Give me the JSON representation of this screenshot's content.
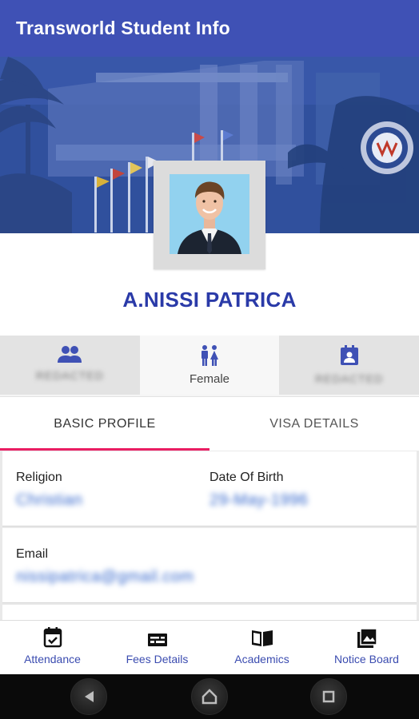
{
  "app": {
    "title": "Transworld Student Info"
  },
  "student": {
    "name": "A.NISSI PATRICA"
  },
  "info_tiles": [
    {
      "icon": "people-icon",
      "value": "REDACTED"
    },
    {
      "icon": "gender-icon",
      "value": "Female"
    },
    {
      "icon": "contact-card-icon",
      "value": "REDACTED"
    }
  ],
  "tabs": [
    {
      "label": "BASIC PROFILE",
      "selected": true
    },
    {
      "label": "VISA DETAILS",
      "selected": false
    }
  ],
  "profile": {
    "religion_label": "Religion",
    "religion_value": "Christian",
    "dob_label": "Date Of Birth",
    "dob_value": "29-May-1996",
    "email_label": "Email",
    "email_value": "nissipatrica@gmail.com"
  },
  "bottom_nav": [
    {
      "label": "Attendance",
      "icon": "calendar-check-icon"
    },
    {
      "label": "Fees Details",
      "icon": "fees-icon"
    },
    {
      "label": "Academics",
      "icon": "book-icon"
    },
    {
      "label": "Notice Board",
      "icon": "image-icon"
    }
  ],
  "system_nav": [
    "back-icon",
    "home-icon",
    "recents-icon"
  ],
  "colors": {
    "primary": "#3f51b5",
    "accent": "#e91e63",
    "name": "#2a3aa8"
  }
}
